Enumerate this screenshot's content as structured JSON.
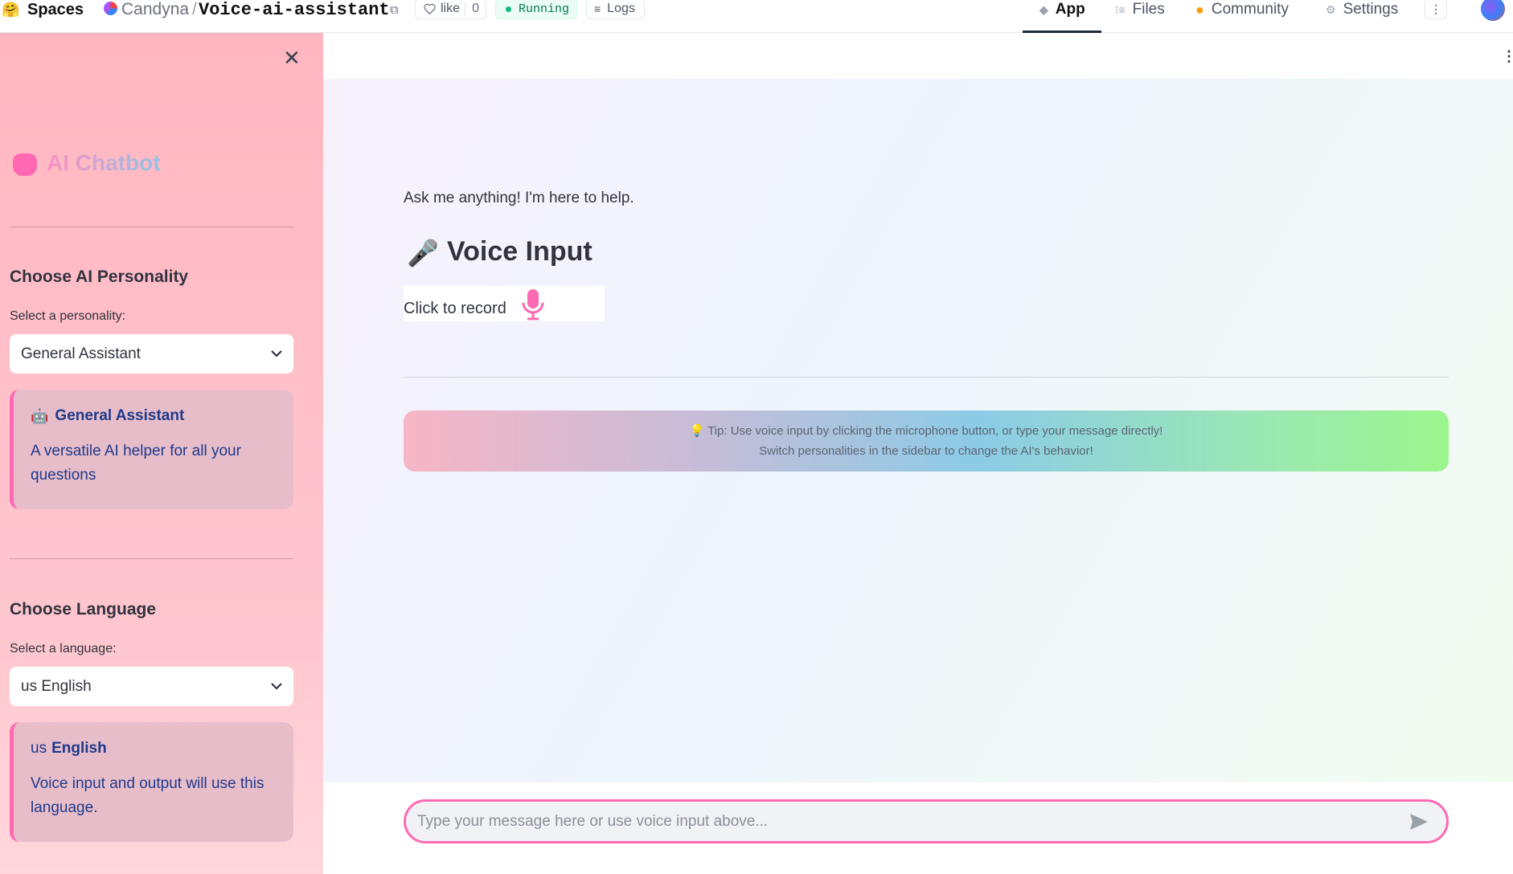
{
  "topbar": {
    "spaces_label": "Spaces",
    "owner": "Candyna",
    "separator": "/",
    "space_name": "Voice-ai-assistant",
    "like_label": "like",
    "like_count": "0",
    "status": "Running",
    "logs_label": "Logs",
    "tabs": [
      {
        "label": "App",
        "icon": "cube-icon",
        "active": true
      },
      {
        "label": "Files",
        "icon": "files-icon",
        "active": false
      },
      {
        "label": "Community",
        "icon": "community-icon",
        "active": false
      },
      {
        "label": "Settings",
        "icon": "gear-icon",
        "active": false
      }
    ],
    "status_color": "#10b981"
  },
  "sidebar": {
    "brand_title": "AI Chatbot",
    "personality_heading": "Choose AI Personality",
    "personality_label": "Select a personality:",
    "personality_value": "General Assistant",
    "personality_card": {
      "icon": "🤖",
      "title": "General Assistant",
      "description": "A versatile AI helper for all your questions"
    },
    "language_heading": "Choose Language",
    "language_label": "Select a language:",
    "language_value": "us English",
    "language_card": {
      "title_prefix": "us",
      "title": "English",
      "description": "Voice input and output will use this language."
    },
    "accent_color": "#ff69b4"
  },
  "main": {
    "intro": "Ask me anything! I'm here to help.",
    "voice_icon": "🎤",
    "voice_title": "Voice Input",
    "record_label": "Click to record",
    "tip_line1": "💡 Tip: Use voice input by clicking the microphone button, or type your message directly!",
    "tip_line2": "Switch personalities in the sidebar to change the AI's behavior!",
    "chat_placeholder": "Type your message here or use voice input above..."
  }
}
